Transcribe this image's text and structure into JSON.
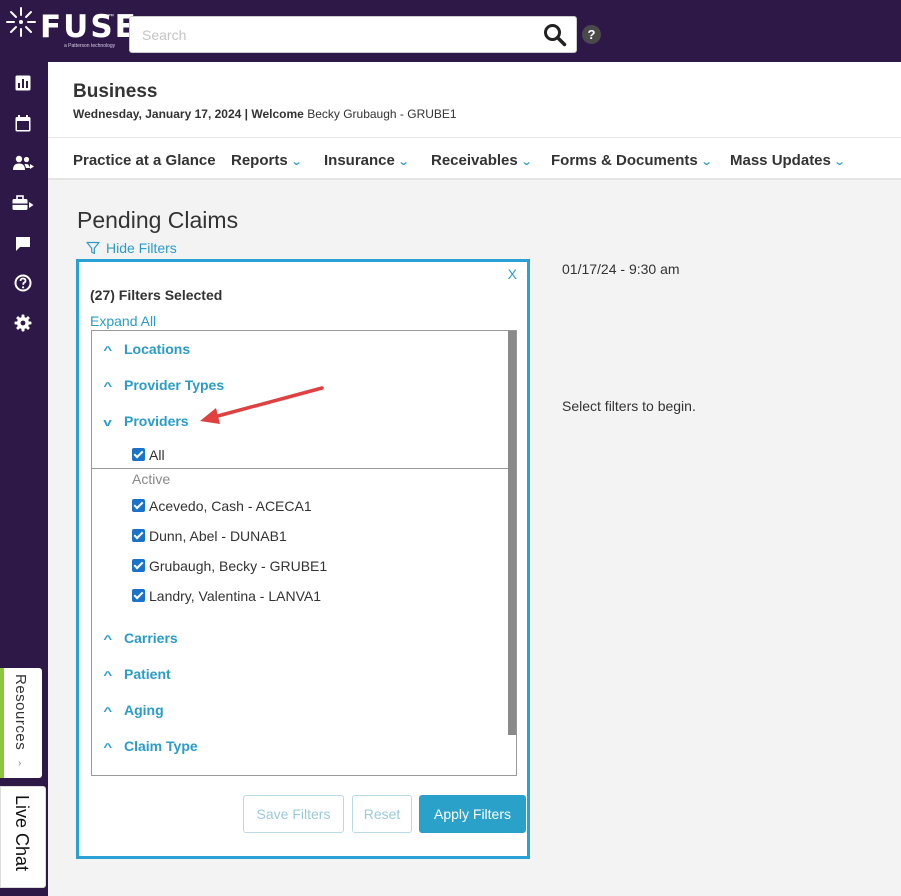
{
  "brand": {
    "name": "FUSE",
    "trademark": "™",
    "tagline": "a Patterson technology"
  },
  "search": {
    "placeholder": "Search",
    "value": ""
  },
  "help_label": "?",
  "rail_icons": [
    "dashboard-icon",
    "calendar-icon",
    "patients-icon",
    "business-icon",
    "messages-icon",
    "help-icon",
    "settings-icon"
  ],
  "side_tabs": {
    "resources": "Resources",
    "resources_chevron": "›",
    "live_chat": "Live Chat"
  },
  "header": {
    "title": "Business",
    "date": "Wednesday, January 17, 2024",
    "separator": "|",
    "welcome_label": "Welcome",
    "user": "Becky Grubaugh - GRUBE1"
  },
  "nav": {
    "items": [
      {
        "label": "Practice at a Glance",
        "dropdown": false
      },
      {
        "label": "Reports",
        "dropdown": true
      },
      {
        "label": "Insurance",
        "dropdown": true
      },
      {
        "label": "Receivables",
        "dropdown": true
      },
      {
        "label": "Forms & Documents",
        "dropdown": true
      },
      {
        "label": "Mass Updates",
        "dropdown": true
      }
    ]
  },
  "main": {
    "title": "Pending Claims",
    "hide_filters": "Hide Filters",
    "timestamp": "01/17/24 - 9:30 am",
    "empty_message": "Select filters to begin."
  },
  "filters": {
    "close_label": "X",
    "selected_count": "(27) Filters Selected",
    "expand_all": "Expand All",
    "sections": {
      "locations": "Locations",
      "provider_types": "Provider Types",
      "providers": "Providers",
      "carriers": "Carriers",
      "patient": "Patient",
      "aging": "Aging",
      "claim_type": "Claim Type"
    },
    "providers": {
      "all_label": "All",
      "group_label": "Active",
      "items": [
        "Acevedo, Cash - ACECA1",
        "Dunn, Abel - DUNAB1",
        "Grubaugh, Becky - GRUBE1",
        "Landry, Valentina - LANVA1"
      ]
    },
    "buttons": {
      "save": "Save Filters",
      "reset": "Reset",
      "apply": "Apply Filters"
    }
  },
  "colors": {
    "topbar": "#2e1847",
    "accent": "#2a9cc7",
    "panel_border": "#2aa1d6",
    "annotation_arrow": "#e04040",
    "resources_accent": "#8cc63f"
  }
}
